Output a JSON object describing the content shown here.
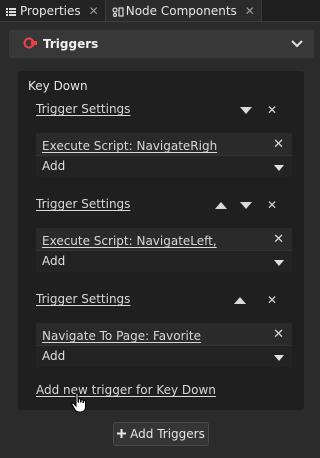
{
  "tabs": [
    {
      "label": "Properties",
      "icon": "list-icon",
      "active": false,
      "close": "✕"
    },
    {
      "label": "Node Components",
      "icon": "components-icon",
      "active": true,
      "close": "✕"
    }
  ],
  "section": {
    "title": "Triggers",
    "icon": "triggers-icon",
    "accent": "#e8424a"
  },
  "event": {
    "label": "Key Down",
    "triggers": [
      {
        "label": "Trigger Settings",
        "controls": [
          "down",
          "close"
        ],
        "action": "Execute Script: NavigateRigh",
        "add_label": "Add"
      },
      {
        "label": "Trigger Settings",
        "controls": [
          "up",
          "down",
          "close"
        ],
        "action": "Execute Script: NavigateLeft,",
        "add_label": "Add"
      },
      {
        "label": "Trigger Settings",
        "controls": [
          "up",
          "close"
        ],
        "action": "Navigate To Page: Favorite",
        "add_label": "Add"
      }
    ],
    "add_new_label": "Add new trigger for Key Down"
  },
  "add_triggers_button": {
    "label": "Add Triggers",
    "icon": "plus-icon"
  }
}
